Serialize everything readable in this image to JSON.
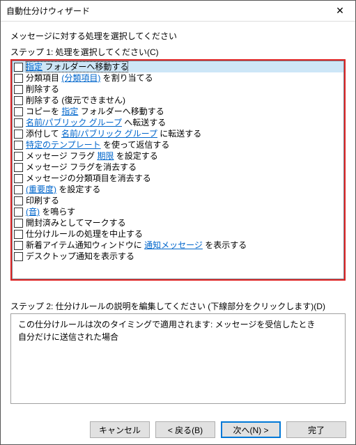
{
  "window": {
    "title": "自動仕分けウィザード"
  },
  "instruction": "メッセージに対する処理を選択してください",
  "step1_label": "ステップ 1: 処理を選択してください(C)",
  "rules": [
    {
      "parts": [
        {
          "t": "link",
          "v": "指定"
        },
        {
          "t": "text",
          "v": " フォルダーへ移動する"
        }
      ],
      "selected": true
    },
    {
      "parts": [
        {
          "t": "text",
          "v": "分類項目 "
        },
        {
          "t": "link",
          "v": "(分類項目)"
        },
        {
          "t": "text",
          "v": " を割り当てる"
        }
      ]
    },
    {
      "parts": [
        {
          "t": "text",
          "v": "削除する"
        }
      ]
    },
    {
      "parts": [
        {
          "t": "text",
          "v": "削除する (復元できません)"
        }
      ]
    },
    {
      "parts": [
        {
          "t": "text",
          "v": "コピーを "
        },
        {
          "t": "link",
          "v": "指定"
        },
        {
          "t": "text",
          "v": " フォルダーへ移動する"
        }
      ]
    },
    {
      "parts": [
        {
          "t": "link",
          "v": "名前/パブリック グループ"
        },
        {
          "t": "text",
          "v": " へ転送する"
        }
      ]
    },
    {
      "parts": [
        {
          "t": "text",
          "v": "添付して "
        },
        {
          "t": "link",
          "v": "名前/パブリック グループ"
        },
        {
          "t": "text",
          "v": " に転送する"
        }
      ]
    },
    {
      "parts": [
        {
          "t": "link",
          "v": "特定のテンプレート"
        },
        {
          "t": "text",
          "v": " を使って返信する"
        }
      ]
    },
    {
      "parts": [
        {
          "t": "text",
          "v": "メッセージ フラグ "
        },
        {
          "t": "link",
          "v": "期限"
        },
        {
          "t": "text",
          "v": " を設定する"
        }
      ]
    },
    {
      "parts": [
        {
          "t": "text",
          "v": "メッセージ フラグを消去する"
        }
      ]
    },
    {
      "parts": [
        {
          "t": "text",
          "v": "メッセージの分類項目を消去する"
        }
      ]
    },
    {
      "parts": [
        {
          "t": "link",
          "v": "(重要度)"
        },
        {
          "t": "text",
          "v": " を設定する"
        }
      ]
    },
    {
      "parts": [
        {
          "t": "text",
          "v": "印刷する"
        }
      ]
    },
    {
      "parts": [
        {
          "t": "link",
          "v": "(音)"
        },
        {
          "t": "text",
          "v": " を鳴らす"
        }
      ]
    },
    {
      "parts": [
        {
          "t": "text",
          "v": "開封済みとしてマークする"
        }
      ]
    },
    {
      "parts": [
        {
          "t": "text",
          "v": "仕分けルールの処理を中止する"
        }
      ]
    },
    {
      "parts": [
        {
          "t": "text",
          "v": "新着アイテム通知ウィンドウに "
        },
        {
          "t": "link",
          "v": "通知メッセージ"
        },
        {
          "t": "text",
          "v": " を表示する"
        }
      ]
    },
    {
      "parts": [
        {
          "t": "text",
          "v": "デスクトップ通知を表示する"
        }
      ]
    }
  ],
  "step2_label": "ステップ 2: 仕分けルールの説明を編集してください (下線部分をクリックします)(D)",
  "description": {
    "line1": "この仕分けルールは次のタイミングで適用されます: メッセージを受信したとき",
    "line2": "自分だけに送信された場合"
  },
  "buttons": {
    "cancel": "キャンセル",
    "back": "< 戻る(B)",
    "next": "次へ(N) >",
    "finish": "完了"
  }
}
